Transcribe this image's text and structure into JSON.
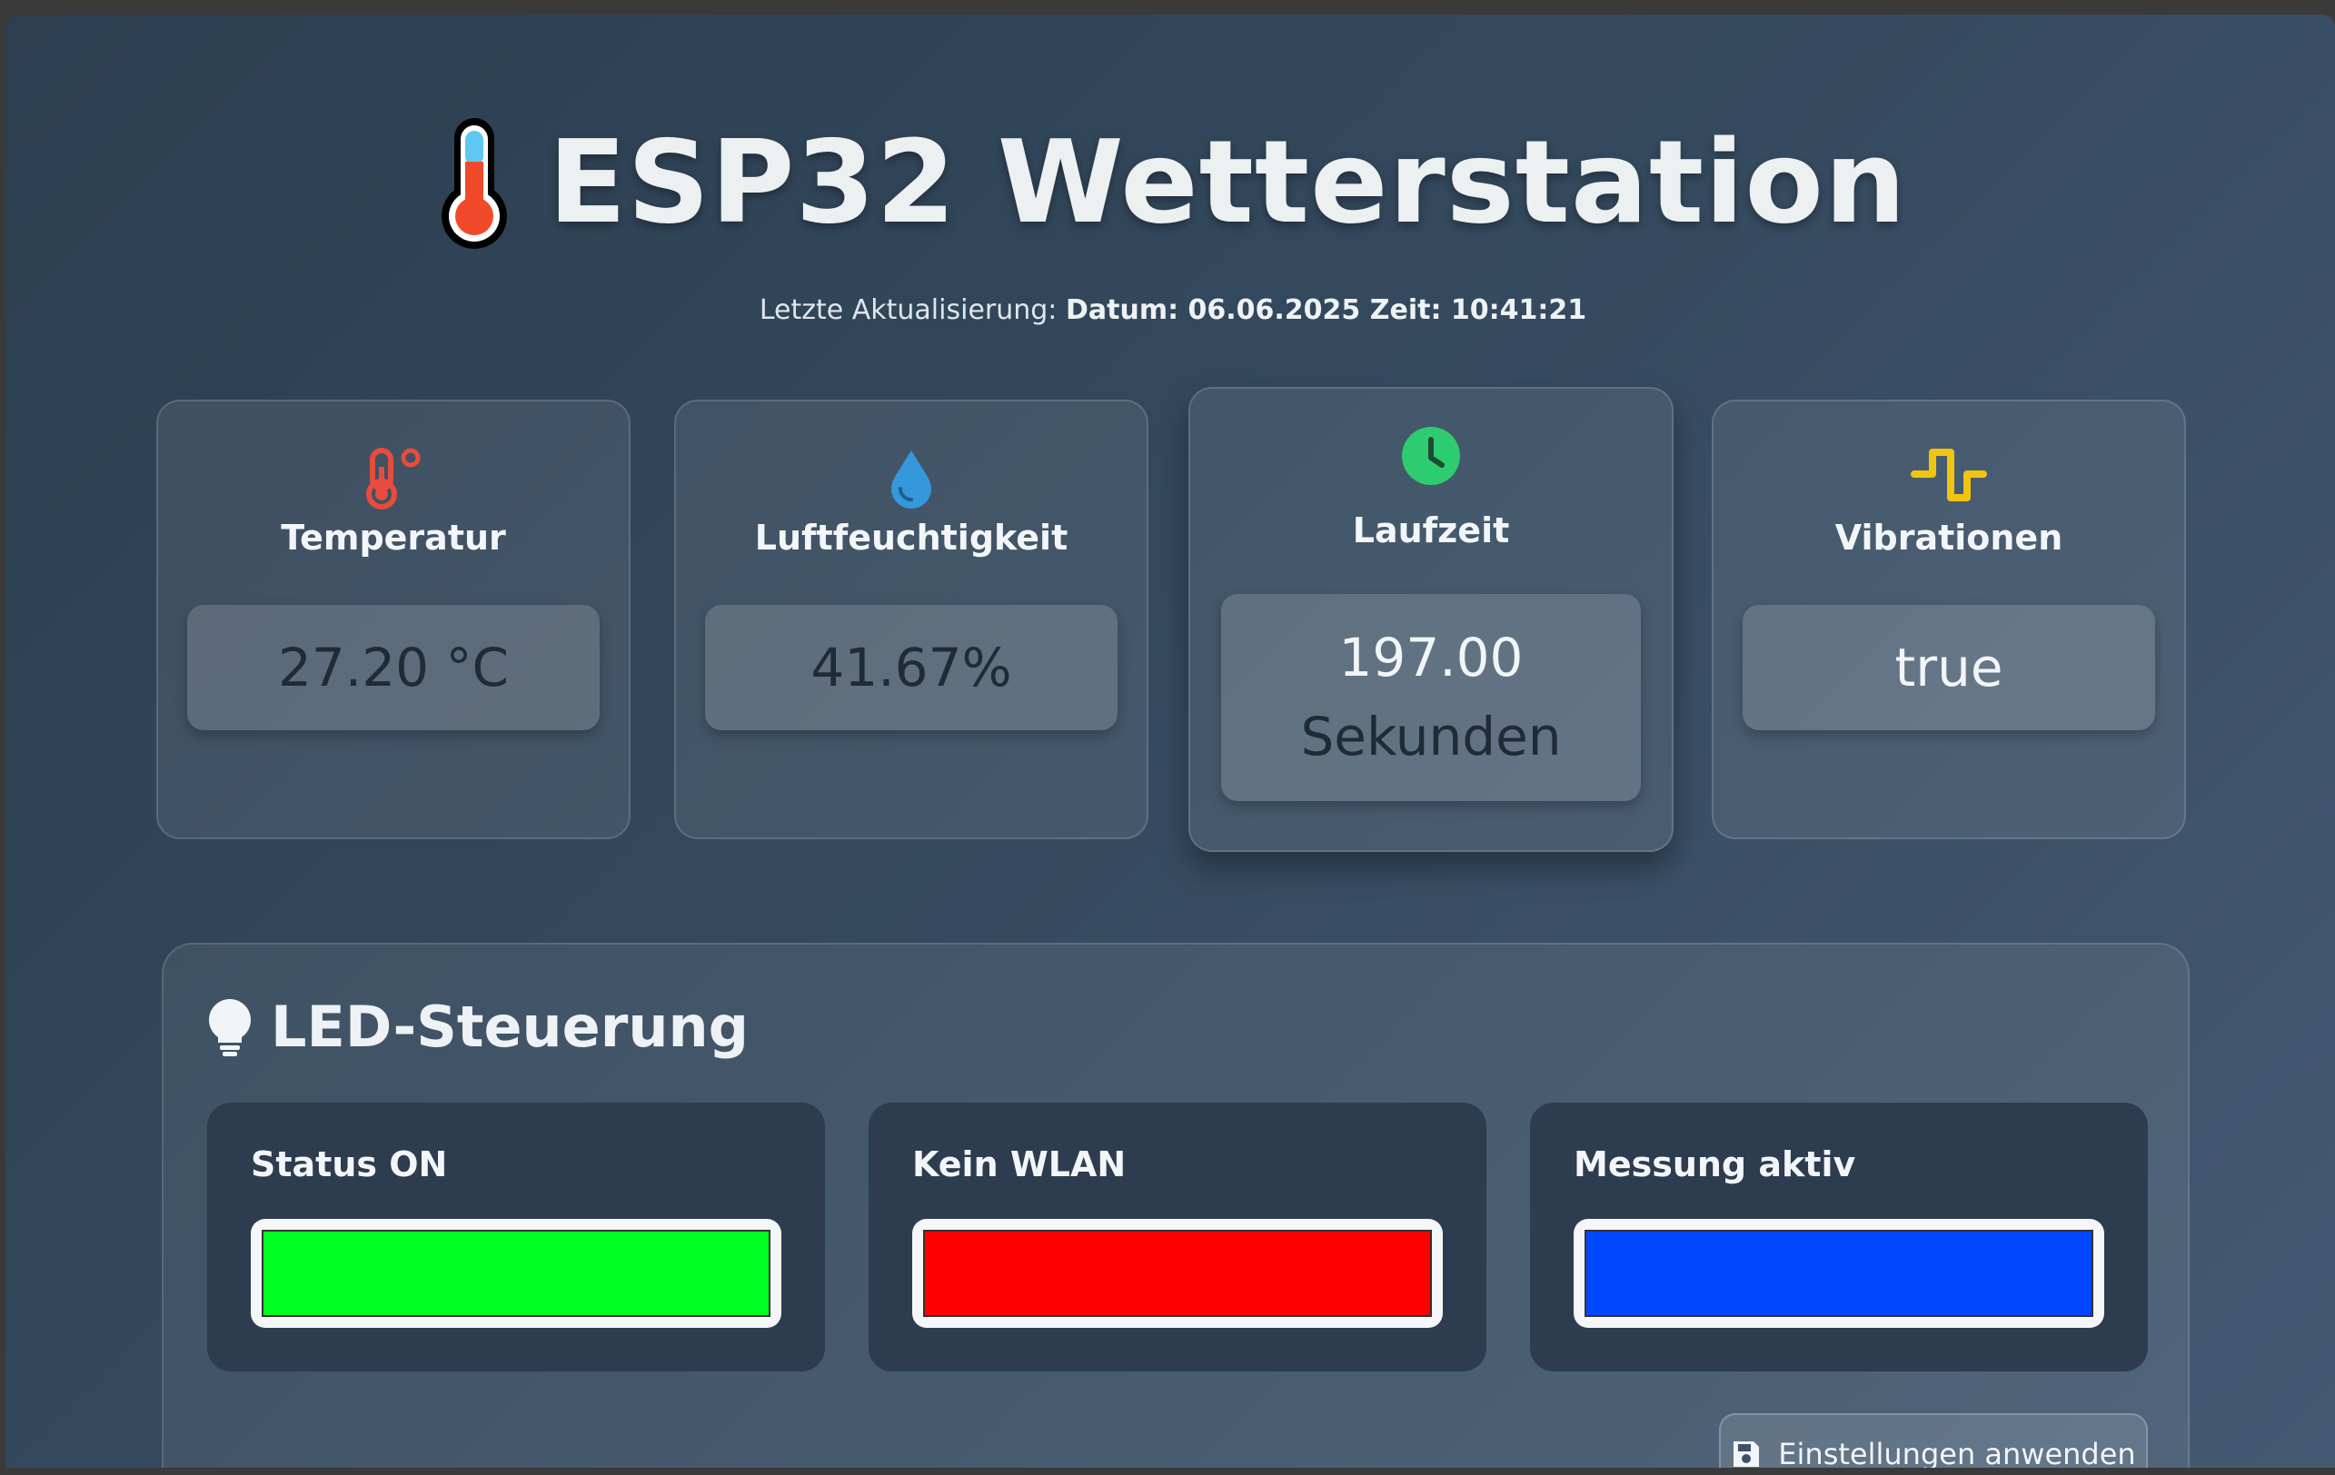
{
  "header": {
    "title": "ESP32 Wetterstation",
    "last_update_label": "Letzte Aktualisierung:",
    "last_update_value": "Datum: 06.06.2025 Zeit: 10:41:21"
  },
  "sensors": [
    {
      "title": "Temperatur",
      "value": "27.20 °C",
      "icon": "thermometer-icon",
      "icon_color": "#e74c3c"
    },
    {
      "title": "Luftfeuchtigkeit",
      "value": "41.67%",
      "icon": "droplet-icon",
      "icon_color": "#3498db"
    },
    {
      "title": "Laufzeit",
      "value_line1": "197.00",
      "value_line2": "Sekunden",
      "icon": "clock-icon",
      "icon_color": "#2ecc71"
    },
    {
      "title": "Vibrationen",
      "value": "true",
      "icon": "wave-icon",
      "icon_color": "#f1c40f"
    }
  ],
  "led": {
    "heading": "LED-Steuerung",
    "items": [
      {
        "label": "Status ON",
        "color": "#00ff22"
      },
      {
        "label": "Kein WLAN",
        "color": "#ff0000"
      },
      {
        "label": "Messung aktiv",
        "color": "#0048ff"
      }
    ],
    "apply_button_label": "Einstellungen anwenden"
  }
}
